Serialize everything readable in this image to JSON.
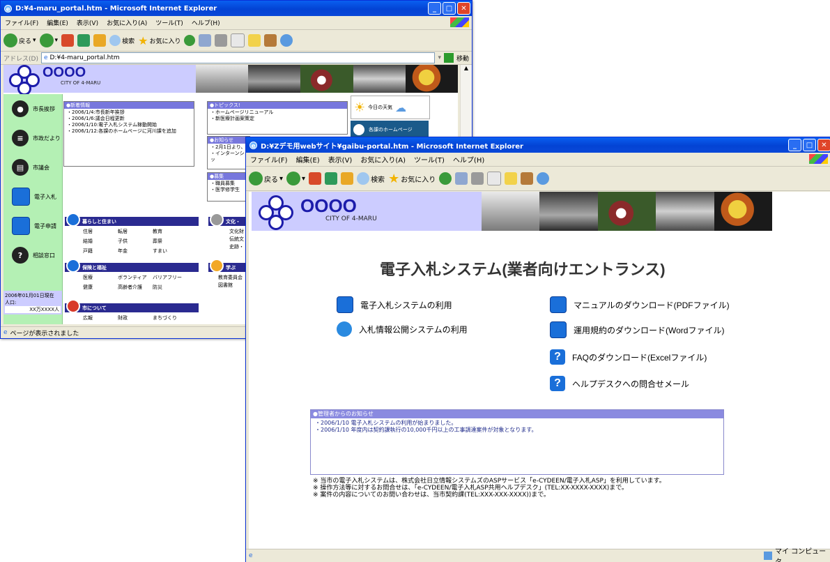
{
  "back": {
    "title": "D:¥4-maru_portal.htm - Microsoft Internet Explorer",
    "menu": [
      "ファイル(F)",
      "編集(E)",
      "表示(V)",
      "お気に入り(A)",
      "ツール(T)",
      "ヘルプ(H)"
    ],
    "toolbar": {
      "back": "戻る",
      "search": "検索",
      "favorites": "お気に入り"
    },
    "address_label": "アドレス(D)",
    "address": "D:¥4-maru_portal.htm",
    "go": "移動",
    "status": "ページが表示されました",
    "logo": {
      "name": "OOOO",
      "sub": "CITY OF 4-MARU"
    },
    "sidebar": [
      "市長挨拶",
      "市政だより",
      "市議会",
      "電子入札",
      "電子申請",
      "相談窓口"
    ],
    "population": {
      "date": "2006年01月01日現在",
      "label": "人口:",
      "value": "XX万XXXX人"
    },
    "news": {
      "header": "●新着情報",
      "items": [
        "・2006/1/4:市長新年挨拶",
        "・2006/1/6:議会日程更新",
        "・2006/1/10:電子入札システム稼動開始",
        "・2006/1/12:各課のホームページに河川課を追加"
      ]
    },
    "topics": {
      "header": "●トピックス!",
      "items": [
        "・ホームページリニューアル",
        "・新医療計画案策定"
      ]
    },
    "oshirase": {
      "header": "●お知らせ",
      "items": [
        "・2月1日より、",
        "・インターンシッ"
      ]
    },
    "boshu": {
      "header": "●募集",
      "items": [
        "・職員募集",
        "・医学修学生"
      ]
    },
    "weather": "今日の天気",
    "dept": "各課のホームページ",
    "categories": [
      {
        "title": "暮らしと住まい",
        "items": [
          "住居",
          "転居",
          "教育",
          "結婚",
          "子供",
          "葬祭",
          "戸籍",
          "年金",
          "すまい"
        ]
      },
      {
        "title": "保険と福祉",
        "items": [
          "医療",
          "ボランティア",
          "バリアフリー",
          "健康",
          "高齢者介護",
          "防災"
        ]
      },
      {
        "title": "市について",
        "items": [
          "広報",
          "財政",
          "まちづくり"
        ]
      }
    ],
    "cat_right": [
      {
        "title": "文化・",
        "items": [
          "文化財",
          "伝統文",
          "史跡・"
        ]
      },
      {
        "title": "学ぶ",
        "items": [
          "教育委員会",
          "図書館"
        ]
      }
    ]
  },
  "front": {
    "title": "D:¥Zデモ用webサイト¥gaibu-portal.htm - Microsoft Internet Explorer",
    "menu": [
      "ファイル(F)",
      "編集(E)",
      "表示(V)",
      "お気に入り(A)",
      "ツール(T)",
      "ヘルプ(H)"
    ],
    "toolbar": {
      "back": "戻る",
      "search": "検索",
      "favorites": "お気に入り"
    },
    "logo": {
      "name": "OOOO",
      "sub": "CITY OF 4-MARU"
    },
    "heading": "電子入札システム(業者向けエントランス)",
    "links_left": [
      "電子入札システムの利用",
      "入札情報公開システムの利用"
    ],
    "links_right": [
      "マニュアルのダウンロード(PDFファイル)",
      "運用規約のダウンロード(Wordファイル)",
      "FAQのダウンロード(Excelファイル)",
      "ヘルプデスクへの問合せメール"
    ],
    "notice": {
      "header": "●管理者からのお知らせ",
      "items": [
        "・2006/1/10  電子入札システムの利用が始まりました。",
        "・2006/1/10  年度内は契約課執行の10,000千円以上の工事調達案件が対象となります。"
      ]
    },
    "footnotes": [
      "※  当市の電子入札システムは、株式会社日立情報システムズのASPサービス「e-CYDEEN/電子入札ASP」を利用しています。",
      "※  操作方法等に対するお問合せは、「e-CYDEEN/電子入札ASP共用ヘルプデスク」(TEL:XX-XXXX-XXXX)まで。",
      "※  案件の内容についてのお問い合わせは、当市契約課(TEL:XXX-XXX-XXXX))まで。"
    ],
    "status_zone": "マイ コンピュータ"
  },
  "colors": {
    "title_blue": "#0343d4",
    "banner": "#ccccff",
    "sidebar_green": "#b4f0b4",
    "panel_header": "#7777dd",
    "category_bar": "#2a2a90"
  }
}
